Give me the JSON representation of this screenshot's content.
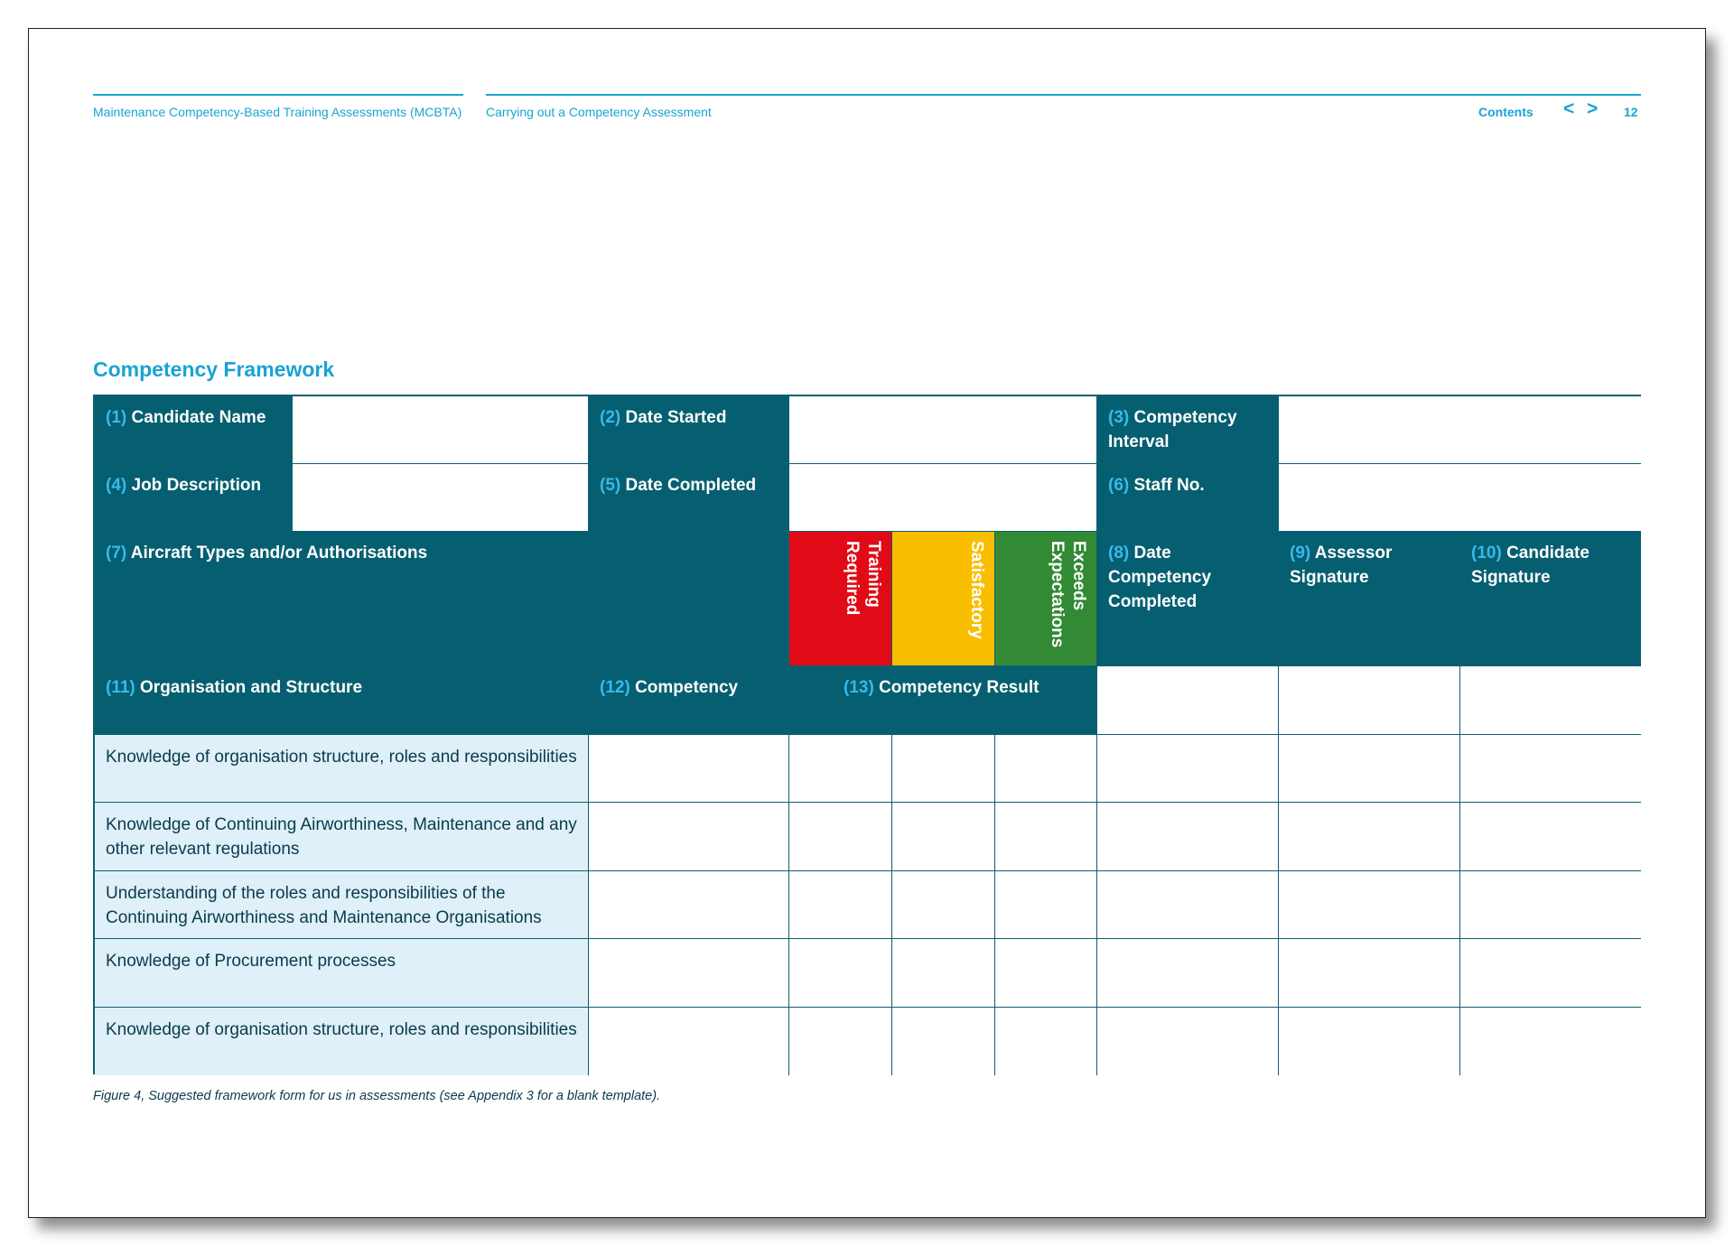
{
  "header": {
    "doc_title": "Maintenance Competency-Based Training Assessments (MCBTA)",
    "section": "Carrying out a Competency Assessment",
    "contents_link": "Contents",
    "prev_symbol": "<",
    "next_symbol": ">",
    "page_number": "12"
  },
  "section_title": "Competency Framework",
  "form": {
    "candidate_name": {
      "num": "(1)",
      "label": " Candidate Name"
    },
    "date_started": {
      "num": "(2)",
      "label": " Date Started"
    },
    "competency_interval": {
      "num": "(3)",
      "label": " Competency Interval"
    },
    "job_description": {
      "num": "(4)",
      "label": " Job Description"
    },
    "date_completed": {
      "num": "(5)",
      "label": " Date Completed"
    },
    "staff_no": {
      "num": "(6)",
      "label": " Staff No."
    },
    "aircraft_types": {
      "num": "(7)",
      "label": " Aircraft Types and/or Authorisations"
    },
    "ratings": {
      "training_required": "Training Required",
      "satisfactory": "Satisfactory",
      "exceeds_expectations": "Exceeds Expectations"
    },
    "date_competency_completed": {
      "num": "(8)",
      "label": " Date Competency Completed"
    },
    "assessor_signature": {
      "num": "(9)",
      "label": " Assessor Signature"
    },
    "candidate_signature": {
      "num": "(10)",
      "label": " Candidate Signature"
    },
    "organisation_structure": {
      "num": "(11)",
      "label": " Organisation and Structure"
    },
    "competency": {
      "num": "(12)",
      "label": " Competency"
    },
    "competency_result": {
      "num": "(13)",
      "label": " Competency Result"
    },
    "rows": [
      "Knowledge of organisation structure, roles and responsibilities",
      "Knowledge of Continuing Airworthiness, Maintenance and any other relevant regulations",
      "Understanding of the roles and responsibilities of the Continuing Airworthiness and Maintenance Organisations",
      "Knowledge of Procurement processes",
      "Knowledge of organisation structure, roles and responsibilities"
    ]
  },
  "caption": "Figure 4, Suggested framework form for us in assessments (see Appendix 3 for a blank template).",
  "colors": {
    "header_accent": "#1aa3d4",
    "dark_teal": "#055f70",
    "label_number": "#38b9ec",
    "row_fill": "#dff0f9",
    "training_required": "#e10b17",
    "satisfactory": "#f9be00",
    "exceeds_expectations": "#328a34"
  }
}
